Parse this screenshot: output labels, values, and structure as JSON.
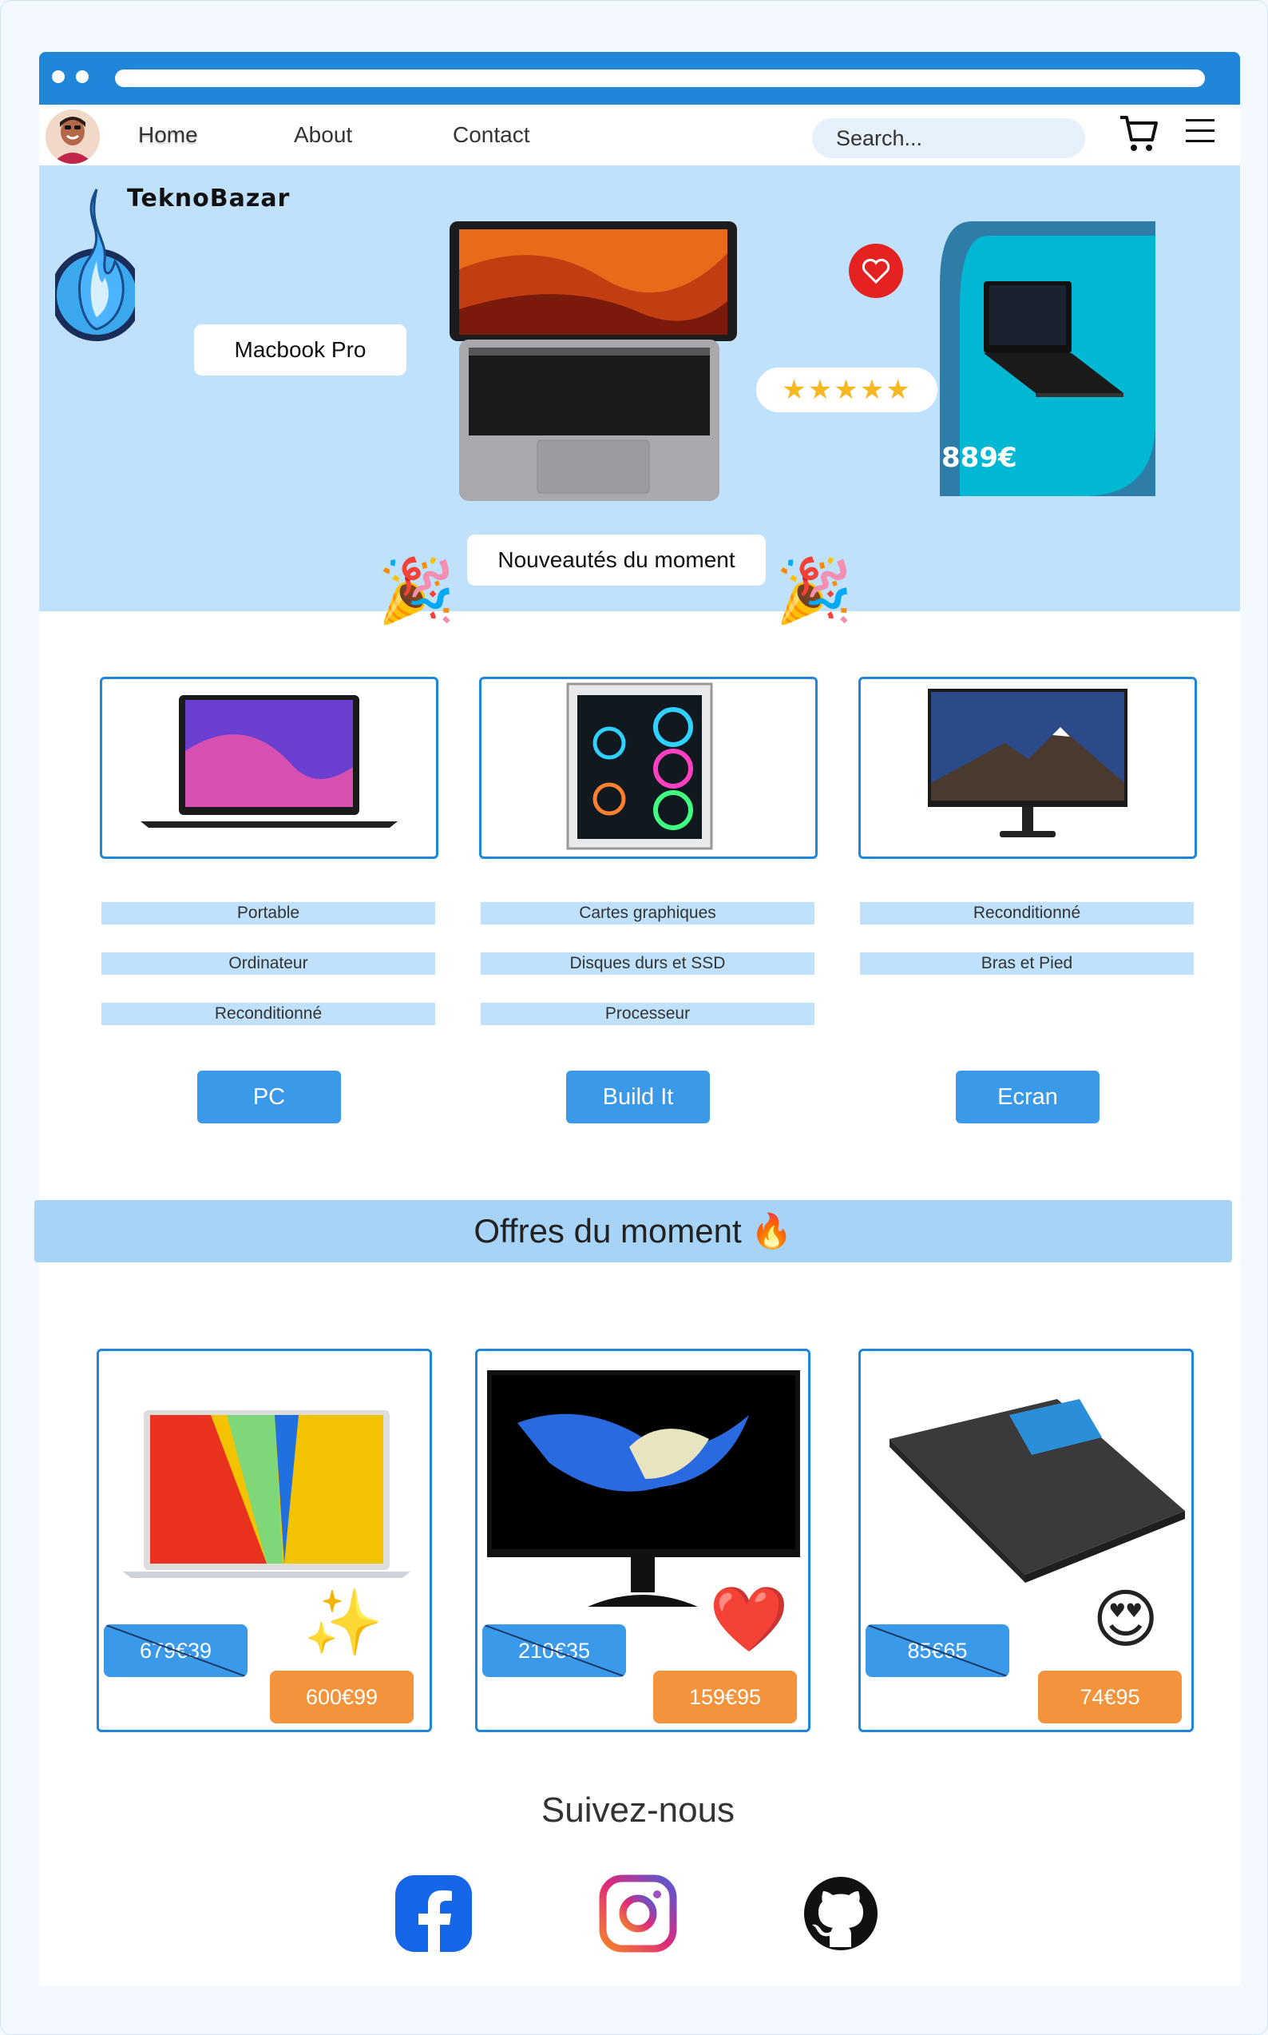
{
  "nav": {
    "home": "Home",
    "about": "About",
    "contact": "Contact",
    "search_placeholder": "Search..."
  },
  "hero": {
    "brand": "TeknoBazar",
    "product_label": "Macbook Pro",
    "promo_price": "889€",
    "banner_text": "Nouveautés du moment",
    "stars": "★★★★★"
  },
  "categories": [
    {
      "labels": [
        "Portable",
        "Ordinateur",
        "Reconditionné"
      ],
      "button": "PC"
    },
    {
      "labels": [
        "Cartes graphiques",
        "Disques durs et SSD",
        "Processeur"
      ],
      "button": "Build It"
    },
    {
      "labels": [
        "Reconditionné",
        "Bras et Pied"
      ],
      "button": "Ecran"
    }
  ],
  "offers": {
    "title": "Offres du moment 🔥",
    "items": [
      {
        "old_price": "679€39",
        "new_price": "600€99",
        "emoji": "✨"
      },
      {
        "old_price": "210€35",
        "new_price": "159€95",
        "emoji": "❤️"
      },
      {
        "old_price": "85€65",
        "new_price": "74€95",
        "emoji": "😍"
      }
    ]
  },
  "footer": {
    "follow": "Suivez-nous"
  },
  "colors": {
    "primary": "#1f86d9",
    "hero_bg": "#bfe1fb",
    "button": "#3b99ea",
    "price_new": "#f3943c",
    "promo_card": "#00b8d4"
  },
  "icons": [
    "cart-icon",
    "hamburger-menu-icon",
    "heart-icon",
    "fire-logo-icon",
    "party-popper-icon",
    "facebook-icon",
    "instagram-icon",
    "github-icon"
  ]
}
